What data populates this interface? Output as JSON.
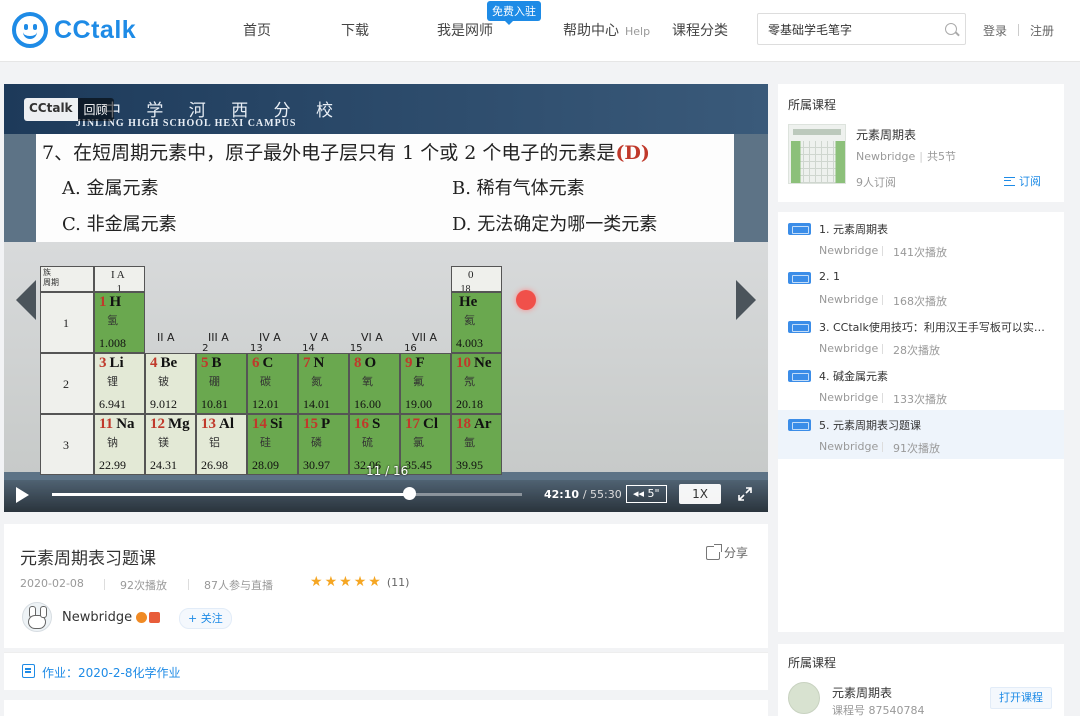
{
  "header": {
    "logo_text": "CCtalk",
    "nav": [
      "首页",
      "下载",
      "我是网师",
      "帮助中心",
      "课程分类"
    ],
    "help_suffix": "Help",
    "free_badge": "免费入驻",
    "search_value": "零基础学毛笔字",
    "login": "登录",
    "register": "注册"
  },
  "player": {
    "school_cn": "中 学 河 西 分 校",
    "school_en": "JINLING HIGH SCHOOL HEXI CAMPUS",
    "tag_brand": "CCtalk",
    "tag_replay": "回顾",
    "question": "7、在短周期元素中，原子最外电子层只有 1 个或 2 个电子的元素是",
    "answer": "(D)",
    "options": [
      "A.  金属元素",
      "B.  稀有气体元素",
      "C.  非金属元素",
      "D.  无法确定为哪一类元素"
    ],
    "page_indicator": "11 / 16",
    "progress": 0.76,
    "time_current": "42:10",
    "time_total": "/ 55:30",
    "skip_label": "◂◂ 5\"",
    "speed": "1X"
  },
  "periodic_table": {
    "corner": "族\n周期",
    "period_labels": [
      "1",
      "2",
      "3"
    ],
    "group_labels": [
      {
        "name": "I A",
        "n": "1"
      },
      {
        "name": "II A",
        "n": "2"
      },
      {
        "name": "III A",
        "n": "13"
      },
      {
        "name": "IV A",
        "n": "14"
      },
      {
        "name": "V A",
        "n": "15"
      },
      {
        "name": "VI A",
        "n": "16"
      },
      {
        "name": "VII A",
        "n": "17"
      },
      {
        "name": "0",
        "n": "18"
      }
    ],
    "elements": [
      {
        "z": "1",
        "sym": "H",
        "cn": "氢",
        "mass": "1.008"
      },
      {
        "z": "",
        "sym": "He",
        "cn": "氦",
        "mass": "4.003"
      },
      {
        "z": "3",
        "sym": "Li",
        "cn": "锂",
        "mass": "6.941"
      },
      {
        "z": "4",
        "sym": "Be",
        "cn": "铍",
        "mass": "9.012"
      },
      {
        "z": "5",
        "sym": "B",
        "cn": "硼",
        "mass": "10.81"
      },
      {
        "z": "6",
        "sym": "C",
        "cn": "碳",
        "mass": "12.01"
      },
      {
        "z": "7",
        "sym": "N",
        "cn": "氮",
        "mass": "14.01"
      },
      {
        "z": "8",
        "sym": "O",
        "cn": "氧",
        "mass": "16.00"
      },
      {
        "z": "9",
        "sym": "F",
        "cn": "氟",
        "mass": "19.00"
      },
      {
        "z": "10",
        "sym": "Ne",
        "cn": "氖",
        "mass": "20.18"
      },
      {
        "z": "11",
        "sym": "Na",
        "cn": "钠",
        "mass": "22.99"
      },
      {
        "z": "12",
        "sym": "Mg",
        "cn": "镁",
        "mass": "24.31"
      },
      {
        "z": "13",
        "sym": "Al",
        "cn": "铝",
        "mass": "26.98"
      },
      {
        "z": "14",
        "sym": "Si",
        "cn": "硅",
        "mass": "28.09"
      },
      {
        "z": "15",
        "sym": "P",
        "cn": "磷",
        "mass": "30.97"
      },
      {
        "z": "16",
        "sym": "S",
        "cn": "硫",
        "mass": "32.06"
      },
      {
        "z": "17",
        "sym": "Cl",
        "cn": "氯",
        "mass": "35.45"
      },
      {
        "z": "18",
        "sym": "Ar",
        "cn": "氩",
        "mass": "39.95"
      }
    ]
  },
  "lesson_info": {
    "title": "元素周期表习题课",
    "share": "分享",
    "date": "2020-02-08",
    "plays": "92次播放",
    "participants": "87人参与直播",
    "rating_count": "(11)",
    "author": "Newbridge",
    "follow": "+ 关注",
    "homework": "作业：2020-2-8化学作业"
  },
  "sidebar": {
    "heading": "所属课程",
    "course_title": "元素周期表",
    "course_author": "Newbridge",
    "course_lessons": "共5节",
    "subscribers": "9人订阅",
    "subscribe": "订阅",
    "lessons": [
      {
        "name": "1. 元素周期表",
        "author": "Newbridge",
        "plays": "141次播放"
      },
      {
        "name": "2. 1",
        "author": "Newbridge",
        "plays": "168次播放"
      },
      {
        "name": "3. CCtalk使用技巧：利用汉王手写板可以实现白...",
        "author": "Newbridge",
        "plays": "28次播放"
      },
      {
        "name": "4. 碱金属元素",
        "author": "Newbridge",
        "plays": "133次播放"
      },
      {
        "name": "5. 元素周期表习题课",
        "author": "Newbridge",
        "plays": "91次播放"
      }
    ]
  },
  "sidebar2": {
    "heading": "所属课程",
    "course_title": "元素周期表",
    "course_id": "课程号 87540784",
    "open_button": "打开课程"
  },
  "colors": {
    "accent": "#1e8be6",
    "element_green": "#6aa84f",
    "answer_red": "#c0392b",
    "star": "#f5a623"
  }
}
